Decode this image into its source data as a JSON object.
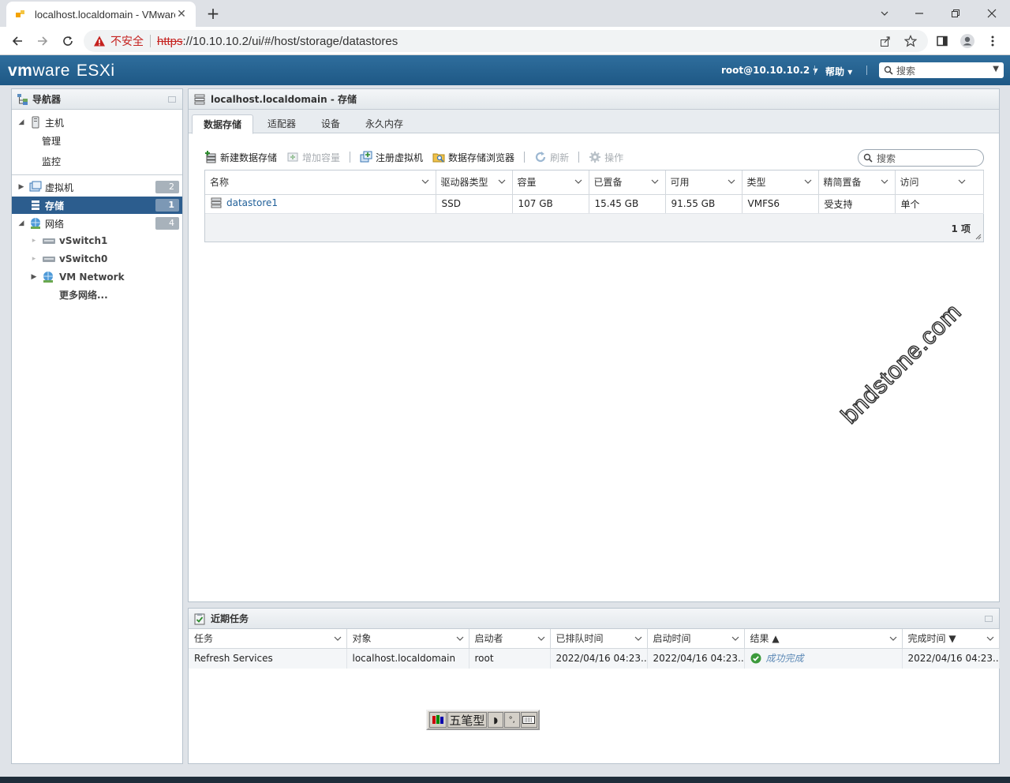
{
  "browser": {
    "tab_title": "localhost.localdomain - VMware",
    "security_label": "不安全",
    "url_scheme": "https",
    "url_rest": "://10.10.10.2/ui/#/host/storage/datastores"
  },
  "header": {
    "brand_vm": "vm",
    "brand_ware": "ware",
    "brand_product": "ESXi",
    "user_menu": "root@10.10.10.2",
    "help_menu": "帮助",
    "search_placeholder": "搜索"
  },
  "navigator": {
    "title": "导航器",
    "items": [
      {
        "label": "主机"
      },
      {
        "label": "管理"
      },
      {
        "label": "监控"
      },
      {
        "label": "虚拟机",
        "badge": "2"
      },
      {
        "label": "存储",
        "badge": "1"
      },
      {
        "label": "网络",
        "badge": "4"
      },
      {
        "label": "vSwitch1"
      },
      {
        "label": "vSwitch0"
      },
      {
        "label": "VM Network"
      },
      {
        "label": "更多网络..."
      }
    ]
  },
  "main": {
    "title": "localhost.localdomain - 存储",
    "tabs": [
      "数据存储",
      "适配器",
      "设备",
      "永久内存"
    ],
    "toolbar": {
      "new_datastore": "新建数据存储",
      "increase_capacity": "增加容量",
      "register_vm": "注册虚拟机",
      "datastore_browser": "数据存储浏览器",
      "refresh": "刷新",
      "actions": "操作"
    },
    "search_placeholder": "搜索",
    "columns": [
      "名称",
      "驱动器类型",
      "容量",
      "已置备",
      "可用",
      "类型",
      "精简置备",
      "访问"
    ],
    "rows": [
      [
        "datastore1",
        "SSD",
        "107 GB",
        "15.45 GB",
        "91.55 GB",
        "VMFS6",
        "受支持",
        "单个"
      ]
    ],
    "count_label": "1 项"
  },
  "tasks": {
    "title": "近期任务",
    "columns": [
      "任务",
      "对象",
      "启动者",
      "已排队时间",
      "启动时间",
      "结果 ▲",
      "完成时间 ▼"
    ],
    "rows": [
      [
        "Refresh Services",
        "localhost.localdomain",
        "root",
        "2022/04/16 04:23...",
        "2022/04/16 04:23...",
        "成功完成",
        "2022/04/16 04:23..."
      ]
    ]
  },
  "ime": {
    "label": "五笔型"
  },
  "watermark": "bndstone.com",
  "colors": {
    "header": "#2f6e9d",
    "selected": "#2c5d8e",
    "link": "#1f5f99"
  }
}
